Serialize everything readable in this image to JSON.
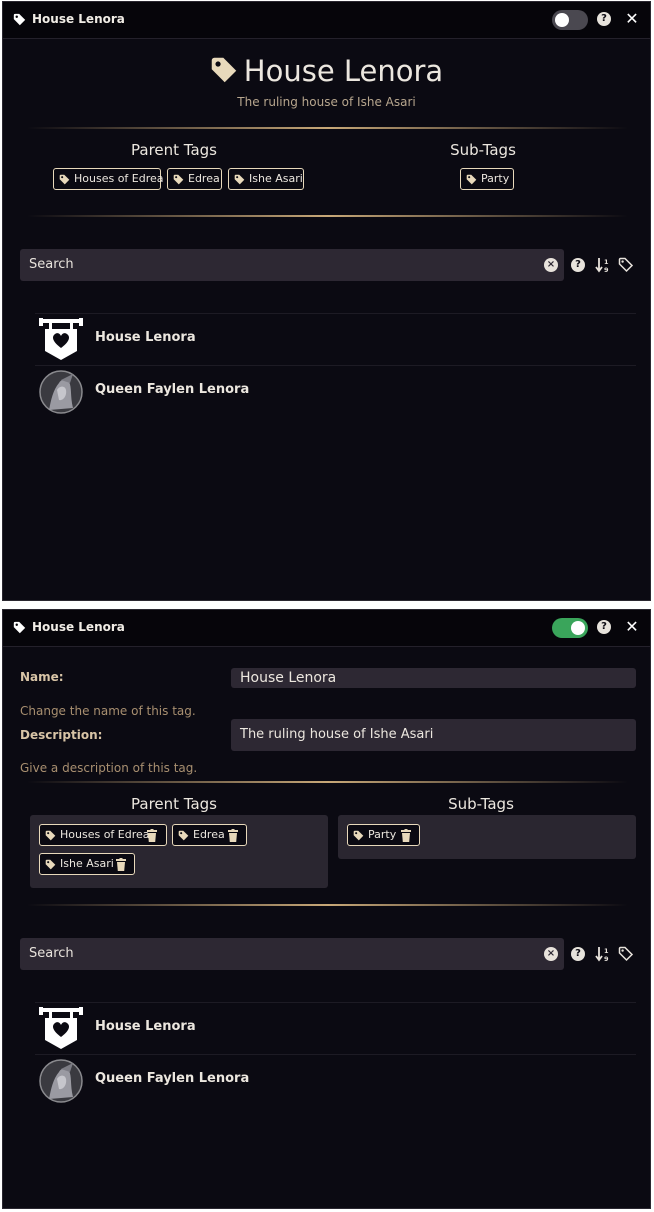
{
  "tag_icon": "tag-icon",
  "colors": {
    "accent": "#c8a878",
    "toggle_on": "#3aa55b",
    "toggle_off": "#4a4850",
    "background": "#0b0a12"
  },
  "view_panel": {
    "window_title": "House Lenora",
    "edit_mode": false,
    "help_label": "?",
    "close_label": "✕",
    "title": "House Lenora",
    "subtitle": "The ruling house of Ishe Asari",
    "parent_tags_heading": "Parent Tags",
    "sub_tags_heading": "Sub-Tags",
    "parent_tags": [
      "Houses of Edrea",
      "Edrea",
      "Ishe Asari"
    ],
    "sub_tags": [
      "Party"
    ],
    "search_placeholder": "Search",
    "results": [
      {
        "name": "House Lenora",
        "icon": "banner-heart-icon"
      },
      {
        "name": "Queen Faylen Lenora",
        "icon": "portrait-avatar"
      }
    ]
  },
  "edit_panel": {
    "window_title": "House Lenora",
    "edit_mode": true,
    "help_label": "?",
    "close_label": "✕",
    "name_label": "Name:",
    "name_value": "House Lenora",
    "name_hint": "Change the name of this tag.",
    "description_label": "Description:",
    "description_value": "The ruling house of Ishe Asari",
    "description_hint": "Give a description of this tag.",
    "parent_tags_heading": "Parent Tags",
    "sub_tags_heading": "Sub-Tags",
    "parent_tags": [
      "Houses of Edrea",
      "Edrea",
      "Ishe Asari"
    ],
    "sub_tags": [
      "Party"
    ],
    "search_placeholder": "Search",
    "results": [
      {
        "name": "House Lenora",
        "icon": "banner-heart-icon"
      },
      {
        "name": "Queen Faylen Lenora",
        "icon": "portrait-avatar"
      }
    ]
  }
}
